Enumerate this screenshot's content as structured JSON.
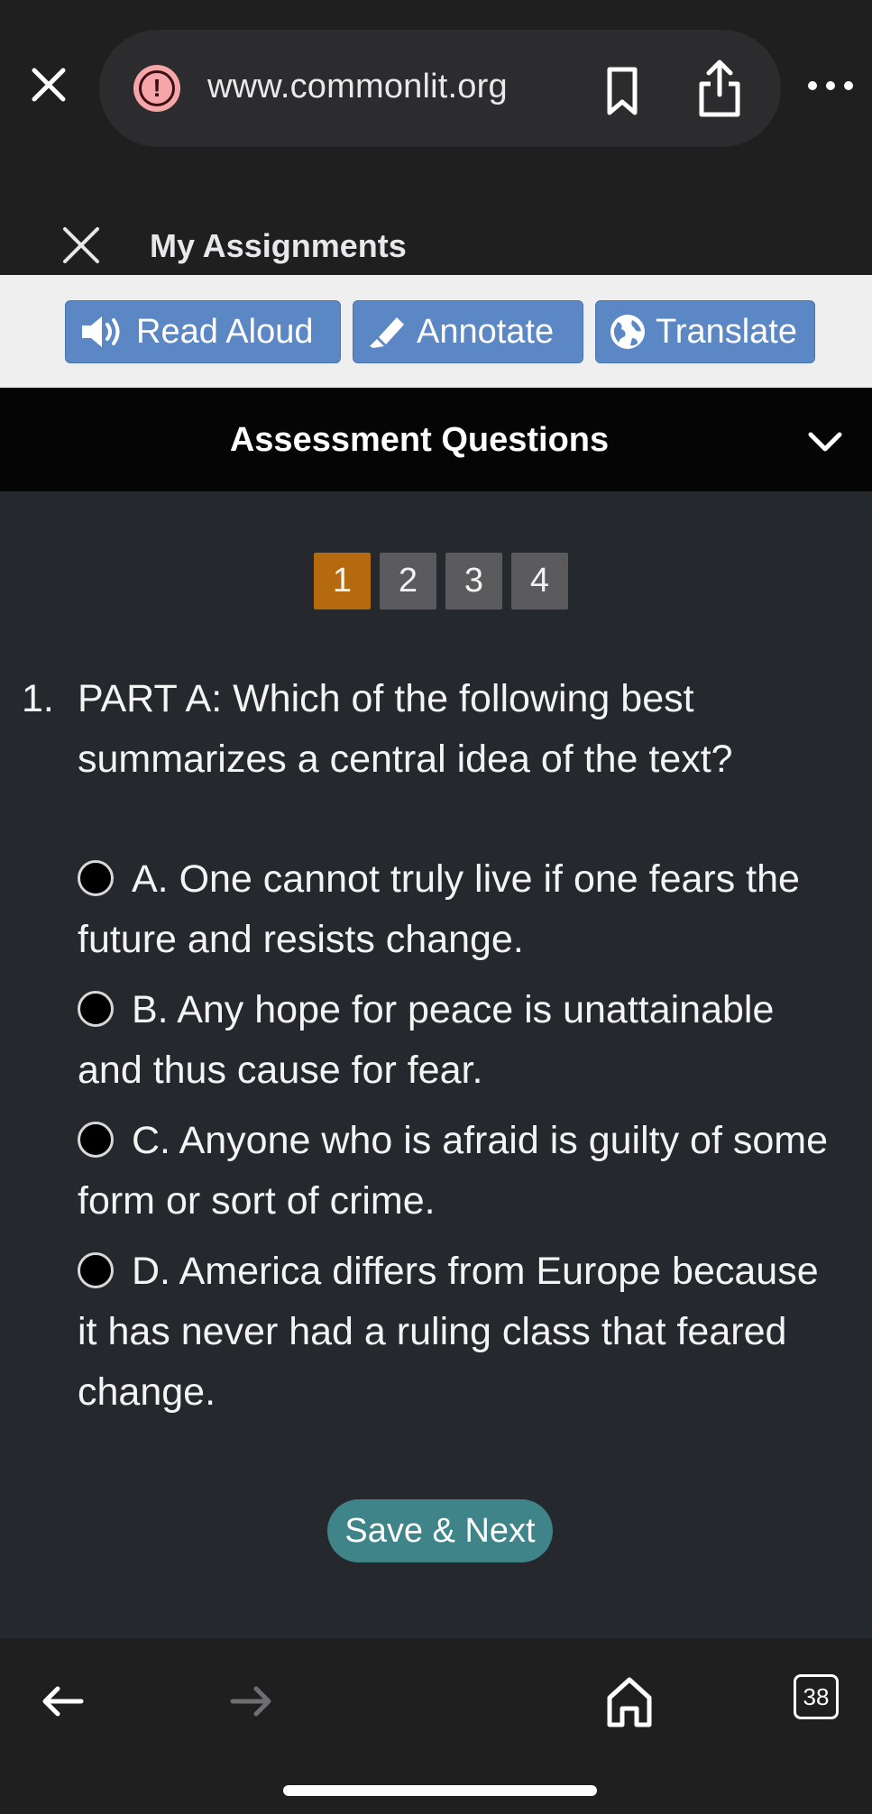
{
  "browser": {
    "url": "www.commonlit.org",
    "tab_count": "38"
  },
  "header": {
    "title": "My Assignments"
  },
  "toolbar": {
    "read_aloud": "Read Aloud",
    "annotate": "Annotate",
    "translate": "Translate",
    "button_color": "#5b88c4"
  },
  "assessment": {
    "title": "Assessment Questions",
    "pages": [
      "1",
      "2",
      "3",
      "4"
    ],
    "active_page": "1",
    "active_color": "#b56a0f",
    "question_number": "1.",
    "question_text": "PART A: Which of the following best summarizes a central idea of the text?",
    "choices": [
      "A. One cannot truly live if one fears the future and resists change.",
      "B. Any hope for peace is unattainable and thus cause for fear.",
      "C. Anyone who is afraid is guilty of some form or sort of crime.",
      "D. America differs from Europe because it has never had a ruling class that feared change."
    ],
    "save_next": "Save & Next",
    "save_color": "#3e8488"
  }
}
